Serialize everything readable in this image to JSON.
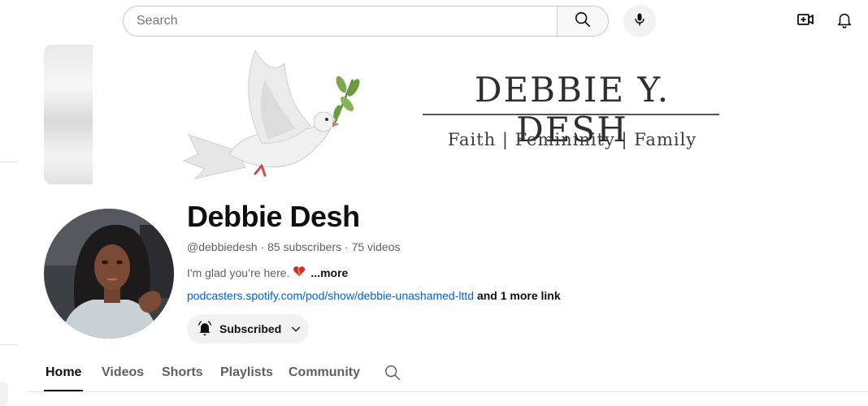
{
  "topbar": {
    "search_placeholder": "Search",
    "icons": [
      "search-icon",
      "microphone-icon",
      "create-video-icon",
      "notifications-bell-icon"
    ]
  },
  "banner": {
    "title": "DEBBIE Y. DESH",
    "tagline": "Faith | Femininity | Family",
    "image": "dove-with-olive-branch"
  },
  "channel": {
    "name": "Debbie Desh",
    "handle": "@debbiedesh",
    "subscribers": "85 subscribers",
    "videos": "75 videos",
    "separator": "·",
    "description": "I'm glad you’re here.",
    "description_emoji": "heart-emoji",
    "more_label": "...more",
    "link_text": "podcasters.spotify.com/pod/show/debbie-unashamed-lttd",
    "extra_links": "and 1 more link",
    "subscribe_label": "Subscribed"
  },
  "tabs": [
    {
      "label": "Home",
      "active": true
    },
    {
      "label": "Videos",
      "active": false
    },
    {
      "label": "Shorts",
      "active": false
    },
    {
      "label": "Playlists",
      "active": false
    },
    {
      "label": "Community",
      "active": false
    }
  ],
  "colors": {
    "link": "#065fd4",
    "text_primary": "#0f0f0f",
    "text_secondary": "#606060",
    "chip_bg": "#f2f2f2"
  }
}
